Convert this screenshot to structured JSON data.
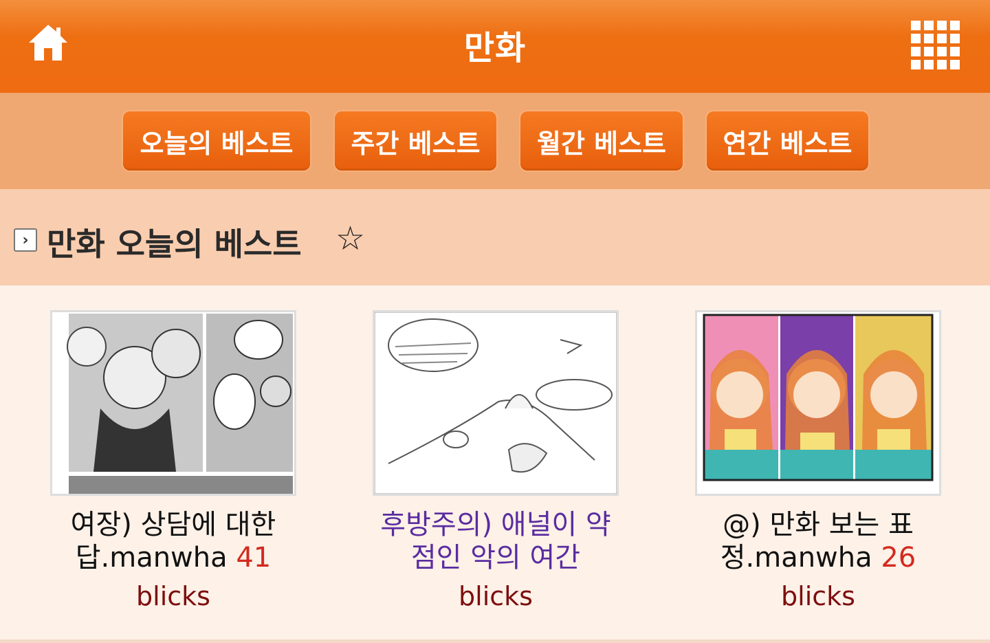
{
  "header": {
    "title": "만화",
    "home_icon": "home-icon",
    "menu_icon": "grid-menu-icon"
  },
  "tabs": [
    {
      "label": "오늘의 베스트"
    },
    {
      "label": "주간 베스트"
    },
    {
      "label": "월간 베스트"
    },
    {
      "label": "연간 베스트"
    }
  ],
  "section": {
    "title": "만화 오늘의 베스트",
    "star": "☆",
    "arrow": "›"
  },
  "items": [
    {
      "title": "여장) 상담에 대한 답.manwha",
      "count": "41",
      "author": "blicks",
      "visited": false
    },
    {
      "title": "후방주의) 애널이 약점인 악의 여간",
      "count": "",
      "author": "blicks",
      "visited": true
    },
    {
      "title": "@) 만화 보는 표정.manwha",
      "count": "26",
      "author": "blicks",
      "visited": false
    }
  ],
  "colors": {
    "header_orange": "#ef6c12",
    "tab_bar": "#f0a872",
    "section_bg": "#f9cdaf",
    "count_red": "#d32a1e",
    "author_red": "#7d0e0e",
    "visited_purple": "#5a2ca0"
  }
}
